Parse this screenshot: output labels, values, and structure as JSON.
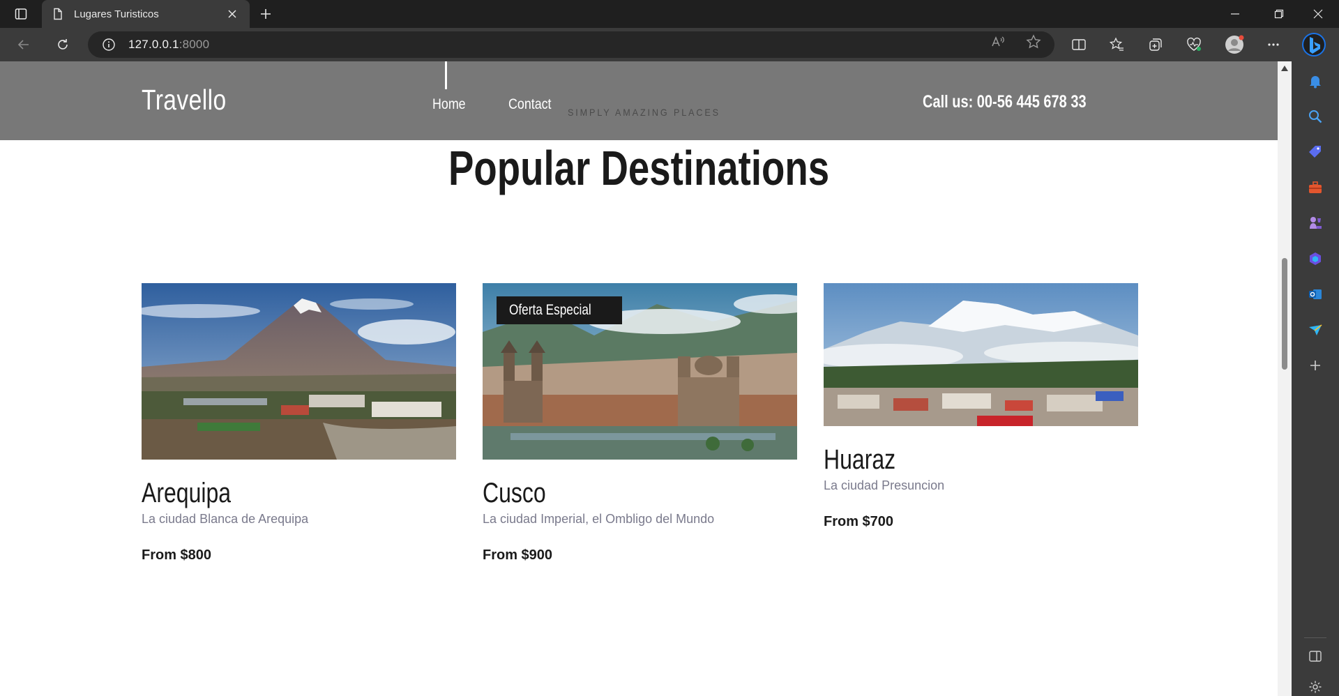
{
  "browser": {
    "tab_title": "Lugares Turisticos",
    "url_host": "127.0.0.1",
    "url_port": ":8000"
  },
  "site": {
    "logo": "Travello",
    "nav": [
      {
        "label": "Home",
        "active": true
      },
      {
        "label": "Contact",
        "active": false
      }
    ],
    "tagline": "SIMPLY AMAZING PLACES",
    "call_us": "Call us: 00-56 445 678 33"
  },
  "section": {
    "title": "Popular Destinations"
  },
  "destinations": [
    {
      "name": "Arequipa",
      "description": "La ciudad Blanca de Arequipa",
      "price": "From $800",
      "badge": ""
    },
    {
      "name": "Cusco",
      "description": "La ciudad Imperial, el Ombligo del Mundo",
      "price": "From $900",
      "badge": "Oferta Especial"
    },
    {
      "name": "Huaraz",
      "description": "La ciudad Presuncion",
      "price": "From $700",
      "badge": ""
    }
  ],
  "colors": {
    "header_bg": "#787878",
    "chrome_dark": "#1f1f1f",
    "chrome_mid": "#3b3b3b",
    "badge_bg": "#1a1a1a",
    "desc_text": "#7a7a8c"
  }
}
